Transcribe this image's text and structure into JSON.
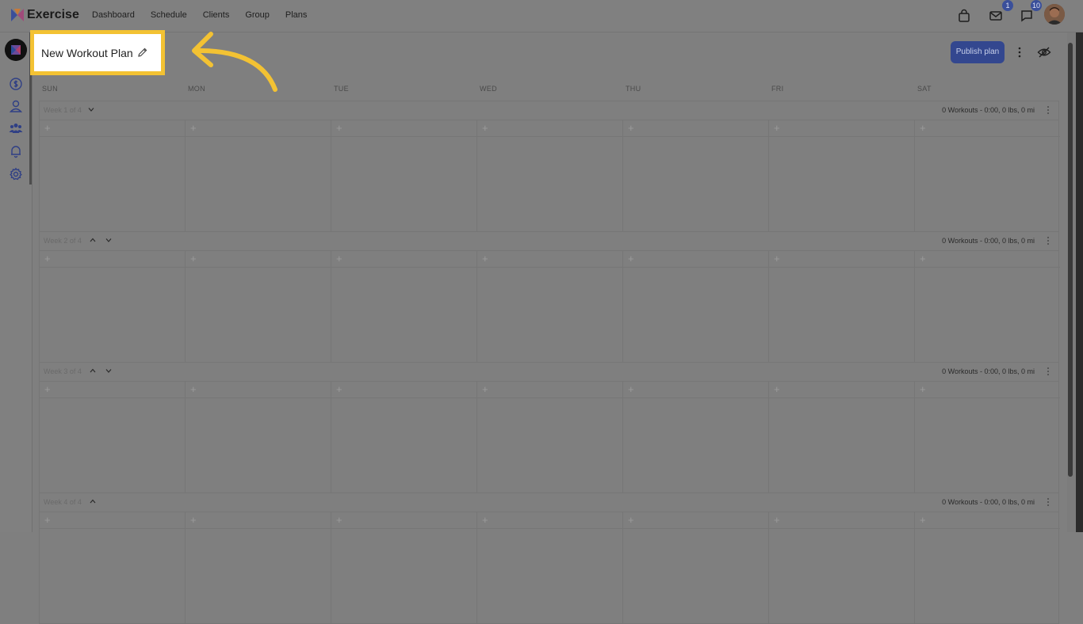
{
  "header": {
    "brand": "Exercise",
    "nav": [
      "Dashboard",
      "Schedule",
      "Clients",
      "Group",
      "Plans"
    ],
    "icons": [
      "shopping-bag-icon",
      "mail-icon",
      "chat-icon"
    ],
    "badges": {
      "mail": "1",
      "chat": "10"
    }
  },
  "sidebar": {
    "icons": [
      "dollar-circle-icon",
      "user-icon",
      "users-icon",
      "bell-icon",
      "gear-icon"
    ]
  },
  "plan": {
    "title": "New Workout Plan",
    "publish_label": "Publish plan"
  },
  "days": [
    "SUN",
    "MON",
    "TUE",
    "WED",
    "THU",
    "FRI",
    "SAT"
  ],
  "weeks": [
    {
      "label": "Week 1 of 4",
      "stats": "0 Workouts - 0:00, 0 lbs, 0 mi"
    },
    {
      "label": "Week 2 of 4",
      "stats": "0 Workouts - 0:00, 0 lbs, 0 mi"
    },
    {
      "label": "Week 3 of 4",
      "stats": "0 Workouts - 0:00, 0 lbs, 0 mi"
    },
    {
      "label": "Week 4 of 4",
      "stats": "0 Workouts - 0:00, 0 lbs, 0 mi"
    }
  ],
  "add_symbol": "+",
  "colors": {
    "highlight": "#f3c233",
    "primary": "#33478f",
    "badge": "#3a4f9a"
  }
}
